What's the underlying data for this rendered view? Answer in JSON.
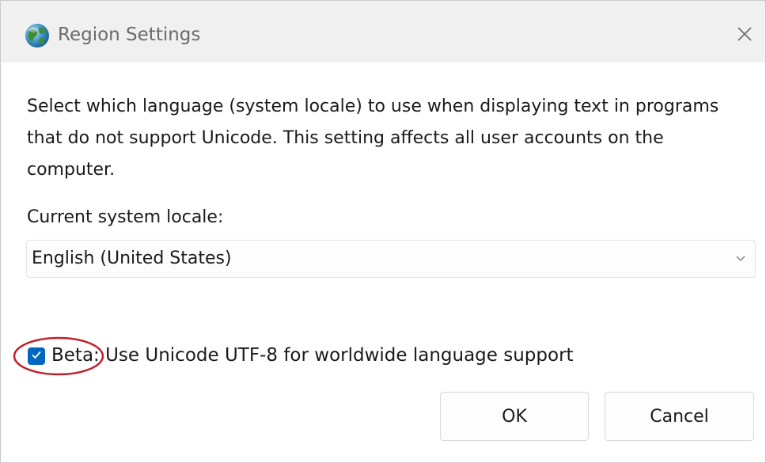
{
  "window": {
    "title": "Region Settings",
    "title_icon": "globe-icon",
    "close_icon": "close-icon"
  },
  "description": "Select which language (system locale) to use when displaying text in programs that do not support Unicode. This setting affects all user accounts on the computer.",
  "locale": {
    "label": "Current system locale:",
    "selected_value": "English (United States)",
    "dropdown_icon": "chevron-down-icon"
  },
  "beta_option": {
    "checked": true,
    "label": "Beta: Use Unicode UTF-8 for worldwide language support"
  },
  "buttons": {
    "ok_label": "OK",
    "cancel_label": "Cancel"
  },
  "colors": {
    "accent": "#0067c0",
    "annotation": "#c0202a"
  }
}
